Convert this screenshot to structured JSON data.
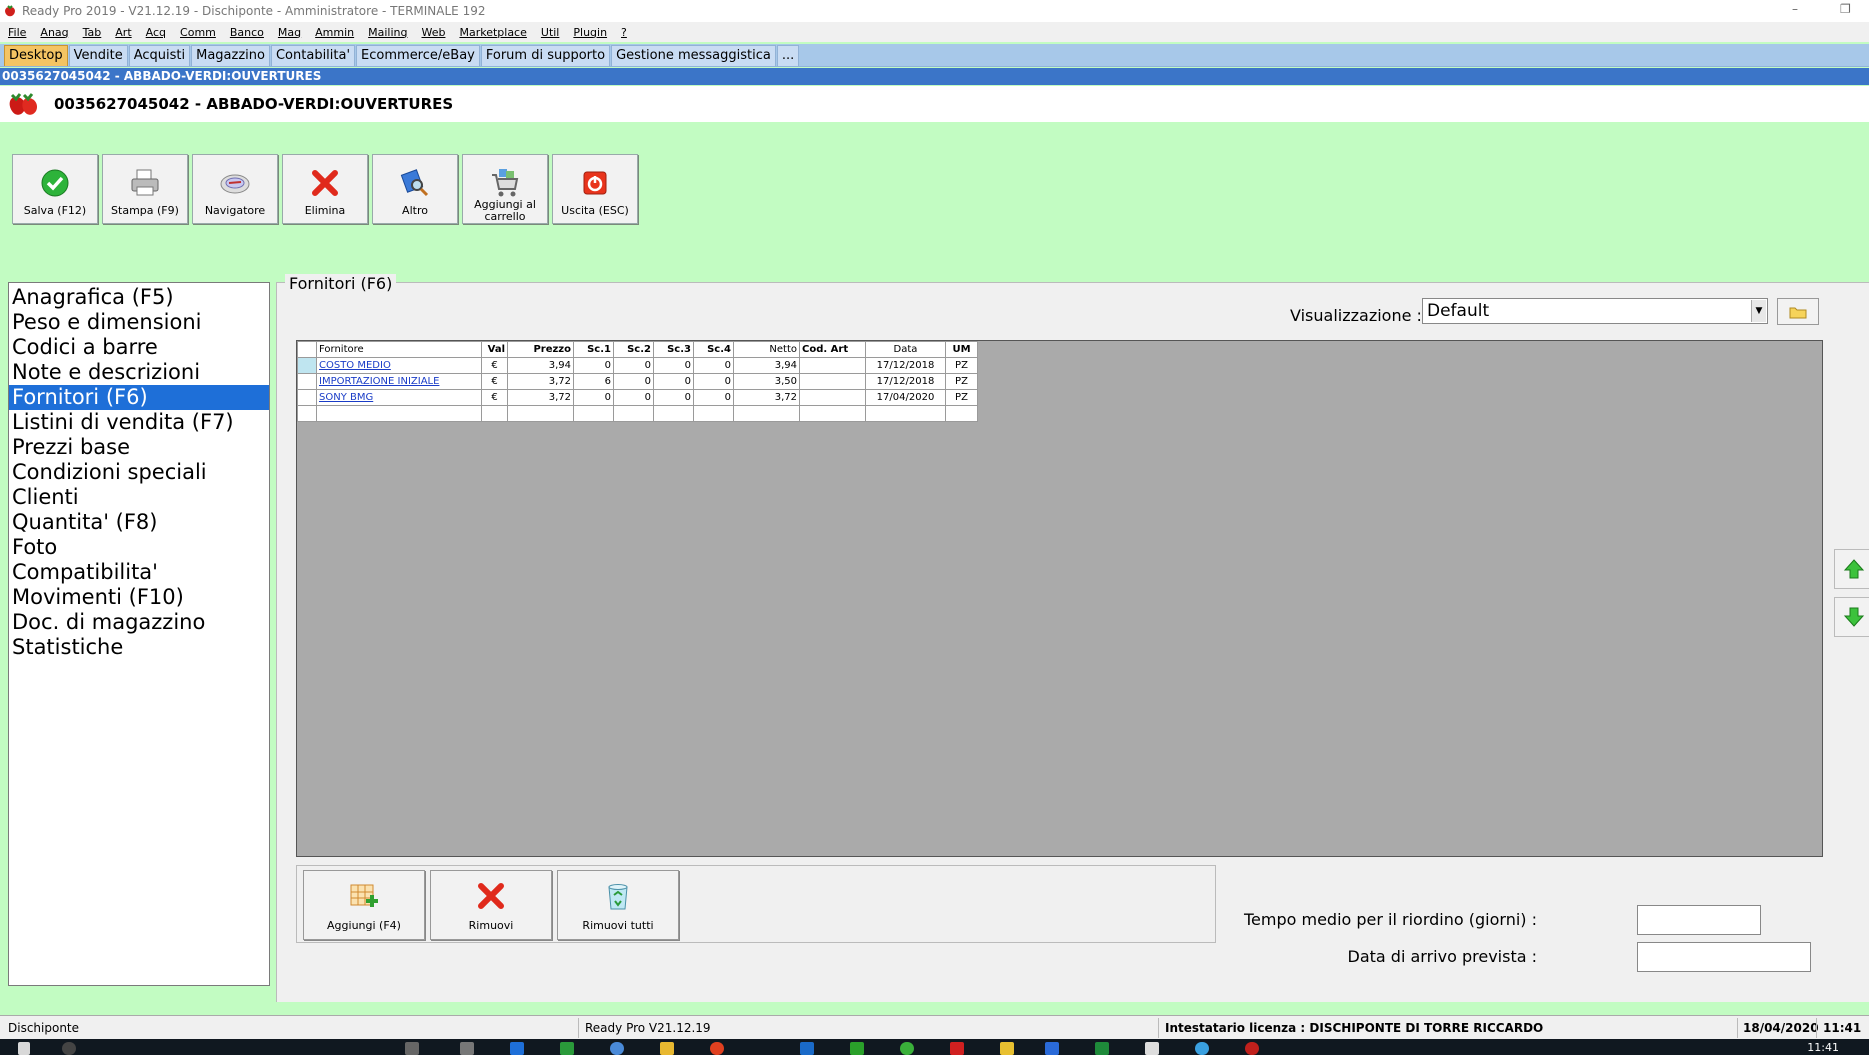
{
  "window": {
    "title": "Ready Pro 2019 - V21.12.19 - Dischiponte - Amministratore - TERMINALE 192",
    "minimize": "–",
    "restore": "❐"
  },
  "menu": [
    "File",
    "Anag",
    "Tab",
    "Art",
    "Acq",
    "Comm",
    "Banco",
    "Mag",
    "Ammin",
    "Mailing",
    "Web",
    "Marketplace",
    "Util",
    "Plugin",
    "?"
  ],
  "tabs": [
    {
      "label": "Desktop",
      "active": true
    },
    {
      "label": "Vendite"
    },
    {
      "label": "Acquisti"
    },
    {
      "label": "Magazzino"
    },
    {
      "label": "Contabilita'"
    },
    {
      "label": "Ecommerce/eBay"
    },
    {
      "label": "Forum di supporto"
    },
    {
      "label": "Gestione messaggistica"
    },
    {
      "label": "..."
    }
  ],
  "record": {
    "strip": "0035627045042 - ABBADO-VERDI:OUVERTURES",
    "title": "0035627045042 - ABBADO-VERDI:OUVERTURES"
  },
  "toolbar": {
    "save": "Salva (F12)",
    "print": "Stampa (F9)",
    "navigator": "Navigatore",
    "delete": "Elimina",
    "other": "Altro",
    "add_cart_1": "Aggiungi al",
    "add_cart_2": "carrello",
    "exit": "Uscita (ESC)"
  },
  "nav": [
    "Anagrafica (F5)",
    "Peso e dimensioni",
    "Codici a barre",
    "Note e descrizioni",
    "Fornitori (F6)",
    "Listini di vendita (F7)",
    "Prezzi base",
    "Condizioni speciali",
    "Clienti",
    "Quantita' (F8)",
    "Foto",
    "Compatibilita'",
    "Movimenti (F10)",
    "Doc. di magazzino",
    "Statistiche"
  ],
  "nav_selected": 4,
  "panel": {
    "title": "Fornitori (F6)",
    "view_label": "Visualizzazione :",
    "view_value": "Default"
  },
  "grid": {
    "headers": [
      "Fornitore",
      "Val",
      "Prezzo",
      "Sc.1",
      "Sc.2",
      "Sc.3",
      "Sc.4",
      "Netto",
      "Cod. Art",
      "Data",
      "UM"
    ],
    "rows": [
      [
        "COSTO MEDIO",
        "€",
        "3,94",
        "0",
        "0",
        "0",
        "0",
        "3,94",
        "",
        "17/12/2018",
        "PZ"
      ],
      [
        "IMPORTAZIONE INIZIALE",
        "€",
        "3,72",
        "6",
        "0",
        "0",
        "0",
        "3,50",
        "",
        "17/12/2018",
        "PZ"
      ],
      [
        "SONY BMG",
        "€",
        "3,72",
        "0",
        "0",
        "0",
        "0",
        "3,72",
        "",
        "17/04/2020",
        "PZ"
      ]
    ]
  },
  "bottom_buttons": {
    "add": "Aggiungi (F4)",
    "remove": "Rimuovi",
    "remove_all": "Rimuovi tutti"
  },
  "fields": {
    "reorder_label": "Tempo medio per il riordino (giorni) :",
    "reorder_value": "",
    "arrival_label": "Data di arrivo prevista :",
    "arrival_value": ""
  },
  "status": {
    "company": "Dischiponte",
    "version": "Ready Pro V21.12.19",
    "license": "Intestatario licenza : DISCHIPONTE DI TORRE RICCARDO",
    "date": "18/04/2020",
    "time": "11:41"
  },
  "taskbar": {
    "clock": "11:41"
  },
  "colors": {
    "background": "#c2fcc2",
    "tab_active": "#f4c463",
    "tab_bar": "#a7c8e9",
    "record_strip": "#3b75c8",
    "nav_selected": "#1e6fd8",
    "grid_bg": "#aaaaaa",
    "link": "#1a3cc7"
  }
}
